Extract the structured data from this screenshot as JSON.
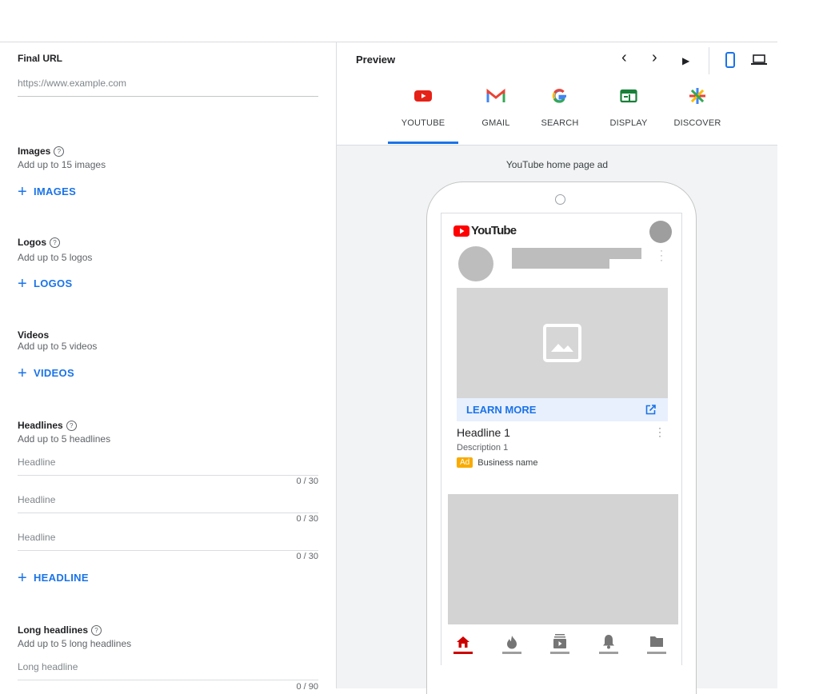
{
  "form": {
    "final_url": {
      "label": "Final URL",
      "placeholder": "https://www.example.com"
    },
    "images": {
      "title": "Images",
      "subtitle": "Add up to 15 images",
      "button": "IMAGES"
    },
    "logos": {
      "title": "Logos",
      "subtitle": "Add up to 5 logos",
      "button": "LOGOS"
    },
    "videos": {
      "title": "Videos",
      "subtitle": "Add up to 5 videos",
      "button": "VIDEOS"
    },
    "headlines": {
      "title": "Headlines",
      "subtitle": "Add up to 5 headlines",
      "fields": [
        {
          "placeholder": "Headline",
          "counter": "0 / 30"
        },
        {
          "placeholder": "Headline",
          "counter": "0 / 30"
        },
        {
          "placeholder": "Headline",
          "counter": "0 / 30"
        }
      ],
      "button": "HEADLINE"
    },
    "long_headlines": {
      "title": "Long headlines",
      "subtitle": "Add up to 5 long headlines",
      "fields": [
        {
          "placeholder": "Long headline",
          "counter": "0 / 90"
        }
      ]
    },
    "help_glyph": "?",
    "plus_glyph": "+"
  },
  "preview": {
    "title": "Preview",
    "controls": {
      "prev": "‹",
      "next": "›",
      "play": "▶"
    },
    "tabs": [
      {
        "label": "YOUTUBE",
        "icon": "youtube-icon",
        "selected": true
      },
      {
        "label": "GMAIL",
        "icon": "gmail-icon",
        "selected": false
      },
      {
        "label": "SEARCH",
        "icon": "google-search-icon",
        "selected": false
      },
      {
        "label": "DISPLAY",
        "icon": "display-icon",
        "selected": false
      },
      {
        "label": "DISCOVER",
        "icon": "discover-icon",
        "selected": false
      }
    ],
    "caption": "YouTube home page ad",
    "ad": {
      "brand": "YouTube",
      "cta": "LEARN MORE",
      "headline": "Headline 1",
      "description": "Description 1",
      "badge": "Ad",
      "business": "Business name"
    }
  },
  "colors": {
    "accent": "#1a73e8",
    "youtube_red": "#ff0000",
    "ad_badge": "#f9ab00",
    "cta_bg": "#e8f0fe"
  }
}
